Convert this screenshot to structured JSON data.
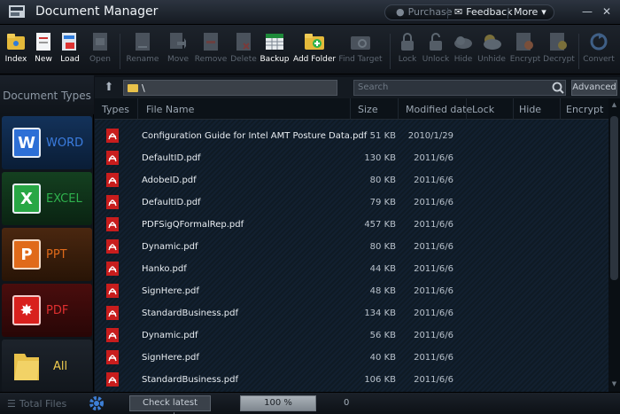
{
  "window": {
    "title": "Document Manager",
    "purchase_label": "Purchase",
    "feedback_label": "Feedback",
    "more_label": "More"
  },
  "toolbar": {
    "items": [
      {
        "label": "Index",
        "icon": "index-folder-icon",
        "enabled": true
      },
      {
        "label": "New",
        "icon": "new-document-icon",
        "enabled": true
      },
      {
        "label": "Load",
        "icon": "load-document-icon",
        "enabled": true
      },
      {
        "label": "Open",
        "icon": "open-document-icon",
        "enabled": false
      },
      {
        "label": "Rename",
        "icon": "rename-icon",
        "enabled": false
      },
      {
        "label": "Move",
        "icon": "move-icon",
        "enabled": false
      },
      {
        "label": "Remove",
        "icon": "remove-icon",
        "enabled": false
      },
      {
        "label": "Delete",
        "icon": "delete-icon",
        "enabled": false
      },
      {
        "label": "Backup",
        "icon": "backup-icon",
        "enabled": true
      },
      {
        "label": "Add Folder",
        "icon": "add-folder-icon",
        "enabled": true
      },
      {
        "label": "Find Target",
        "icon": "find-target-icon",
        "enabled": false
      },
      {
        "label": "Lock",
        "icon": "lock-icon",
        "enabled": false
      },
      {
        "label": "Unlock",
        "icon": "unlock-icon",
        "enabled": false
      },
      {
        "label": "Hide",
        "icon": "hide-icon",
        "enabled": false
      },
      {
        "label": "Unhide",
        "icon": "unhide-icon",
        "enabled": false
      },
      {
        "label": "Encrypt",
        "icon": "encrypt-icon",
        "enabled": false
      },
      {
        "label": "Decrypt",
        "icon": "decrypt-icon",
        "enabled": false
      },
      {
        "label": "Convert",
        "icon": "convert-icon",
        "enabled": false
      }
    ]
  },
  "sidebar": {
    "header": "Document Types",
    "items": [
      {
        "label": "WORD",
        "icon": "word-icon",
        "color": "#2d6fd6"
      },
      {
        "label": "EXCEL",
        "icon": "excel-icon",
        "color": "#28a745"
      },
      {
        "label": "PPT",
        "icon": "ppt-icon",
        "color": "#e06a1a"
      },
      {
        "label": "PDF",
        "icon": "pdf-icon",
        "color": "#d8201d"
      },
      {
        "label": "All",
        "icon": "all-folder-icon",
        "color": "#e8c14a"
      }
    ]
  },
  "nav": {
    "path": "\\",
    "search_placeholder": "Search",
    "advanced_label": "Advanced"
  },
  "list": {
    "columns": [
      "Types",
      "File Name",
      "Size",
      "Modified date",
      "Lock",
      "Hide",
      "Encrypt"
    ],
    "rows": [
      {
        "name": "Configuration Guide for Intel AMT Posture Data.pdf",
        "size": "51 KB",
        "date": "2010/1/29"
      },
      {
        "name": "DefaultID.pdf",
        "size": "130 KB",
        "date": "2011/6/6"
      },
      {
        "name": "AdobeID.pdf",
        "size": "80 KB",
        "date": "2011/6/6"
      },
      {
        "name": "DefaultID.pdf",
        "size": "79 KB",
        "date": "2011/6/6"
      },
      {
        "name": "PDFSigQFormalRep.pdf",
        "size": "457 KB",
        "date": "2011/6/6"
      },
      {
        "name": "Dynamic.pdf",
        "size": "80 KB",
        "date": "2011/6/6"
      },
      {
        "name": "Hanko.pdf",
        "size": "44 KB",
        "date": "2011/6/6"
      },
      {
        "name": "SignHere.pdf",
        "size": "48 KB",
        "date": "2011/6/6"
      },
      {
        "name": "StandardBusiness.pdf",
        "size": "134 KB",
        "date": "2011/6/6"
      },
      {
        "name": "Dynamic.pdf",
        "size": "56 KB",
        "date": "2011/6/6"
      },
      {
        "name": "SignHere.pdf",
        "size": "40 KB",
        "date": "2011/6/6"
      },
      {
        "name": "StandardBusiness.pdf",
        "size": "106 KB",
        "date": "2011/6/6"
      }
    ]
  },
  "status": {
    "total_files_label": "Total Files",
    "check_label": "Check latest version",
    "progress_text": "100 %",
    "progress_fraction": 1.0,
    "count": "0"
  }
}
